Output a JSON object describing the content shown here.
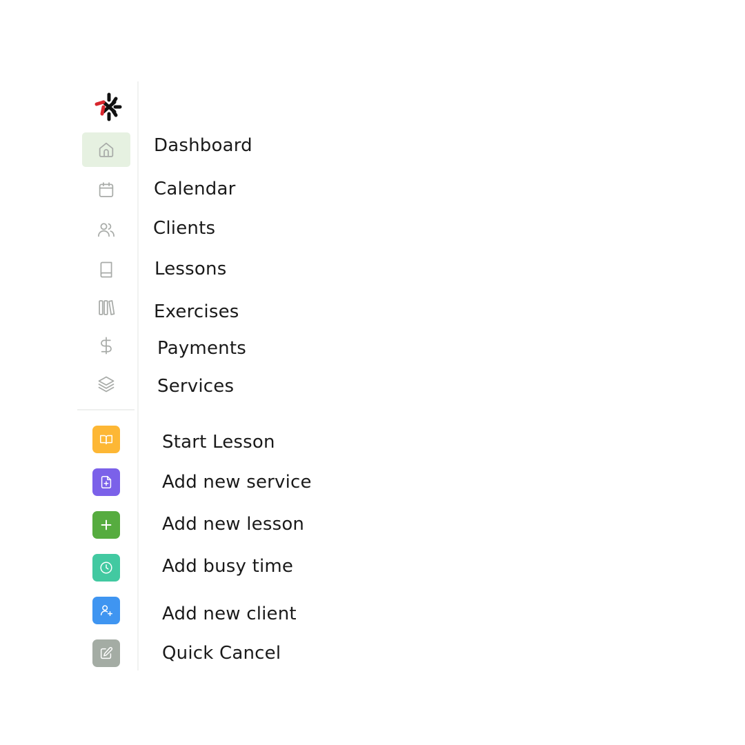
{
  "nav": {
    "items": [
      {
        "label": "Dashboard",
        "icon": "home-icon",
        "active": true
      },
      {
        "label": "Calendar",
        "icon": "calendar-icon"
      },
      {
        "label": "Clients",
        "icon": "users-icon"
      },
      {
        "label": "Lessons",
        "icon": "book-icon"
      },
      {
        "label": "Exercises",
        "icon": "library-icon"
      },
      {
        "label": "Payments",
        "icon": "dollar-icon"
      },
      {
        "label": "Services",
        "icon": "layers-icon"
      }
    ],
    "active_background": "#e6f1e1",
    "icon_color": "#a8aba8"
  },
  "actions": {
    "items": [
      {
        "label": "Start Lesson",
        "icon": "open-book-icon",
        "color": "#fdb735"
      },
      {
        "label": "Add new service",
        "icon": "file-plus-icon",
        "color": "#7b61e9"
      },
      {
        "label": "Add new lesson",
        "icon": "plus-icon",
        "color": "#56ac3f"
      },
      {
        "label": "Add busy time",
        "icon": "clock-icon",
        "color": "#42c9a1"
      },
      {
        "label": "Add new client",
        "icon": "user-plus-icon",
        "color": "#3f95f1"
      },
      {
        "label": "Quick Cancel",
        "icon": "edit-icon",
        "color": "#a4aca4"
      }
    ]
  },
  "logo": {
    "icon": "brand-logo-icon",
    "colors": [
      "#111111",
      "#d8262d"
    ]
  }
}
